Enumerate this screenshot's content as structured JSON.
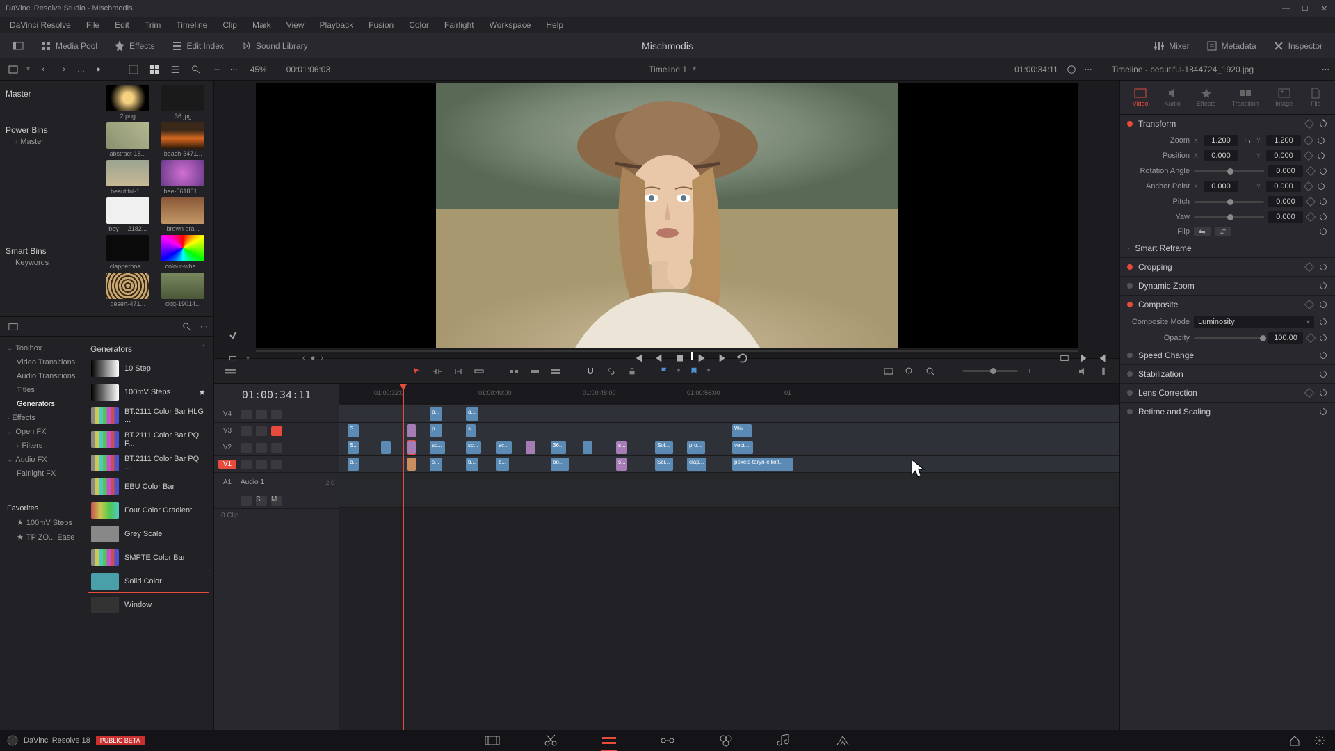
{
  "titlebar": {
    "text": "DaVinci Resolve Studio - Mischmodis"
  },
  "menu": [
    "DaVinci Resolve",
    "File",
    "Edit",
    "Trim",
    "Timeline",
    "Clip",
    "Mark",
    "View",
    "Playback",
    "Fusion",
    "Color",
    "Fairlight",
    "Workspace",
    "Help"
  ],
  "toolbar": {
    "media_pool": "Media Pool",
    "effects": "Effects",
    "edit_index": "Edit Index",
    "sound_library": "Sound Library",
    "project": "Mischmodis",
    "mixer": "Mixer",
    "metadata": "Metadata",
    "inspector": "Inspector"
  },
  "secondbar": {
    "zoom": "45%",
    "tc1": "00:01:06:03",
    "timeline_name": "Timeline 1",
    "tc2": "01:00:34:11",
    "clip_name": "Timeline - beautiful-1844724_1920.jpg"
  },
  "media_tree": {
    "master": "Master",
    "power_bins": "Power Bins",
    "master2": "Master",
    "smart_bins": "Smart Bins",
    "keywords": "Keywords"
  },
  "thumbs": [
    {
      "label": "2.png",
      "cls": "tb-lens"
    },
    {
      "label": "36.jpg",
      "cls": "tb-dark"
    },
    {
      "label": "abstract-18...",
      "cls": "tb-abstract"
    },
    {
      "label": "beach-3471...",
      "cls": "tb-beach"
    },
    {
      "label": "beautiful-1...",
      "cls": "tb-woman"
    },
    {
      "label": "bee-561801...",
      "cls": "tb-bee"
    },
    {
      "label": "boy_-_2182...",
      "cls": "tb-boy"
    },
    {
      "label": "brown gra...",
      "cls": "tb-brown"
    },
    {
      "label": "clapperboa...",
      "cls": "tb-clapper"
    },
    {
      "label": "colour-whe...",
      "cls": "tb-wheel"
    },
    {
      "label": "desert-471...",
      "cls": "tb-leopard"
    },
    {
      "label": "dog-19014...",
      "cls": "tb-dog"
    }
  ],
  "fx_tree": {
    "toolbox": "Toolbox",
    "video_transitions": "Video Transitions",
    "audio_transitions": "Audio Transitions",
    "titles": "Titles",
    "generators": "Generators",
    "effects": "Effects",
    "openfx": "Open FX",
    "filters": "Filters",
    "audiofx": "Audio FX",
    "fairlightfx": "Fairlight FX",
    "favorites": "Favorites",
    "fav1": "100mV Steps",
    "fav2": "TP ZO... Ease"
  },
  "generators": {
    "header": "Generators",
    "items": [
      {
        "name": "10 Step",
        "cls": "gen-bw",
        "star": false
      },
      {
        "name": "100mV Steps",
        "cls": "gen-bw",
        "star": true
      },
      {
        "name": "BT.2111 Color Bar HLG ...",
        "cls": "gen-bars",
        "star": false
      },
      {
        "name": "BT.2111 Color Bar PQ F...",
        "cls": "gen-bars",
        "star": false
      },
      {
        "name": "BT.2111 Color Bar PQ ...",
        "cls": "gen-bars",
        "star": false
      },
      {
        "name": "EBU Color Bar",
        "cls": "gen-bars",
        "star": false
      },
      {
        "name": "Four Color Gradient",
        "cls": "gen-grad",
        "star": false
      },
      {
        "name": "Grey Scale",
        "cls": "gen-grey",
        "star": false
      },
      {
        "name": "SMPTE Color Bar",
        "cls": "gen-bars",
        "star": false
      },
      {
        "name": "Solid Color",
        "cls": "gen-solid",
        "star": false,
        "selected": true
      },
      {
        "name": "Window",
        "cls": "gen-window",
        "star": false
      }
    ]
  },
  "timeline": {
    "tc": "01:00:34:11",
    "tracks": {
      "v4": "V4",
      "v3": "V3",
      "v2": "V2",
      "v1": "V1",
      "a1": "A1",
      "a1_name": "Audio 1",
      "a1_ch": "2.0",
      "clip_zero": "0 Clip"
    },
    "ruler": [
      "01:00:32:0",
      "01:00:40:00",
      "01:00:48:00",
      "01:00:56:00",
      "01"
    ]
  },
  "inspector": {
    "tabs": {
      "video": "Video",
      "audio": "Audio",
      "effects": "Effects",
      "transition": "Transition",
      "image": "Image",
      "file": "File"
    },
    "transform": {
      "title": "Transform",
      "zoom": "Zoom",
      "zoom_x": "1.200",
      "zoom_y": "1.200",
      "position": "Position",
      "pos_x": "0.000",
      "pos_y": "0.000",
      "rotation": "Rotation Angle",
      "rot_val": "0.000",
      "anchor": "Anchor Point",
      "anc_x": "0.000",
      "anc_y": "0.000",
      "pitch": "Pitch",
      "pitch_val": "0.000",
      "yaw": "Yaw",
      "yaw_val": "0.000",
      "flip": "Flip"
    },
    "smart_reframe": "Smart Reframe",
    "cropping": "Cropping",
    "dynamic_zoom": "Dynamic Zoom",
    "composite": {
      "title": "Composite",
      "mode": "Composite Mode",
      "mode_val": "Luminosity",
      "opacity": "Opacity",
      "opacity_val": "100.00"
    },
    "speed": "Speed Change",
    "stabilization": "Stabilization",
    "lens": "Lens Correction",
    "retime": "Retime and Scaling"
  },
  "footer": {
    "version": "DaVinci Resolve 18",
    "beta": "PUBLIC BETA"
  }
}
